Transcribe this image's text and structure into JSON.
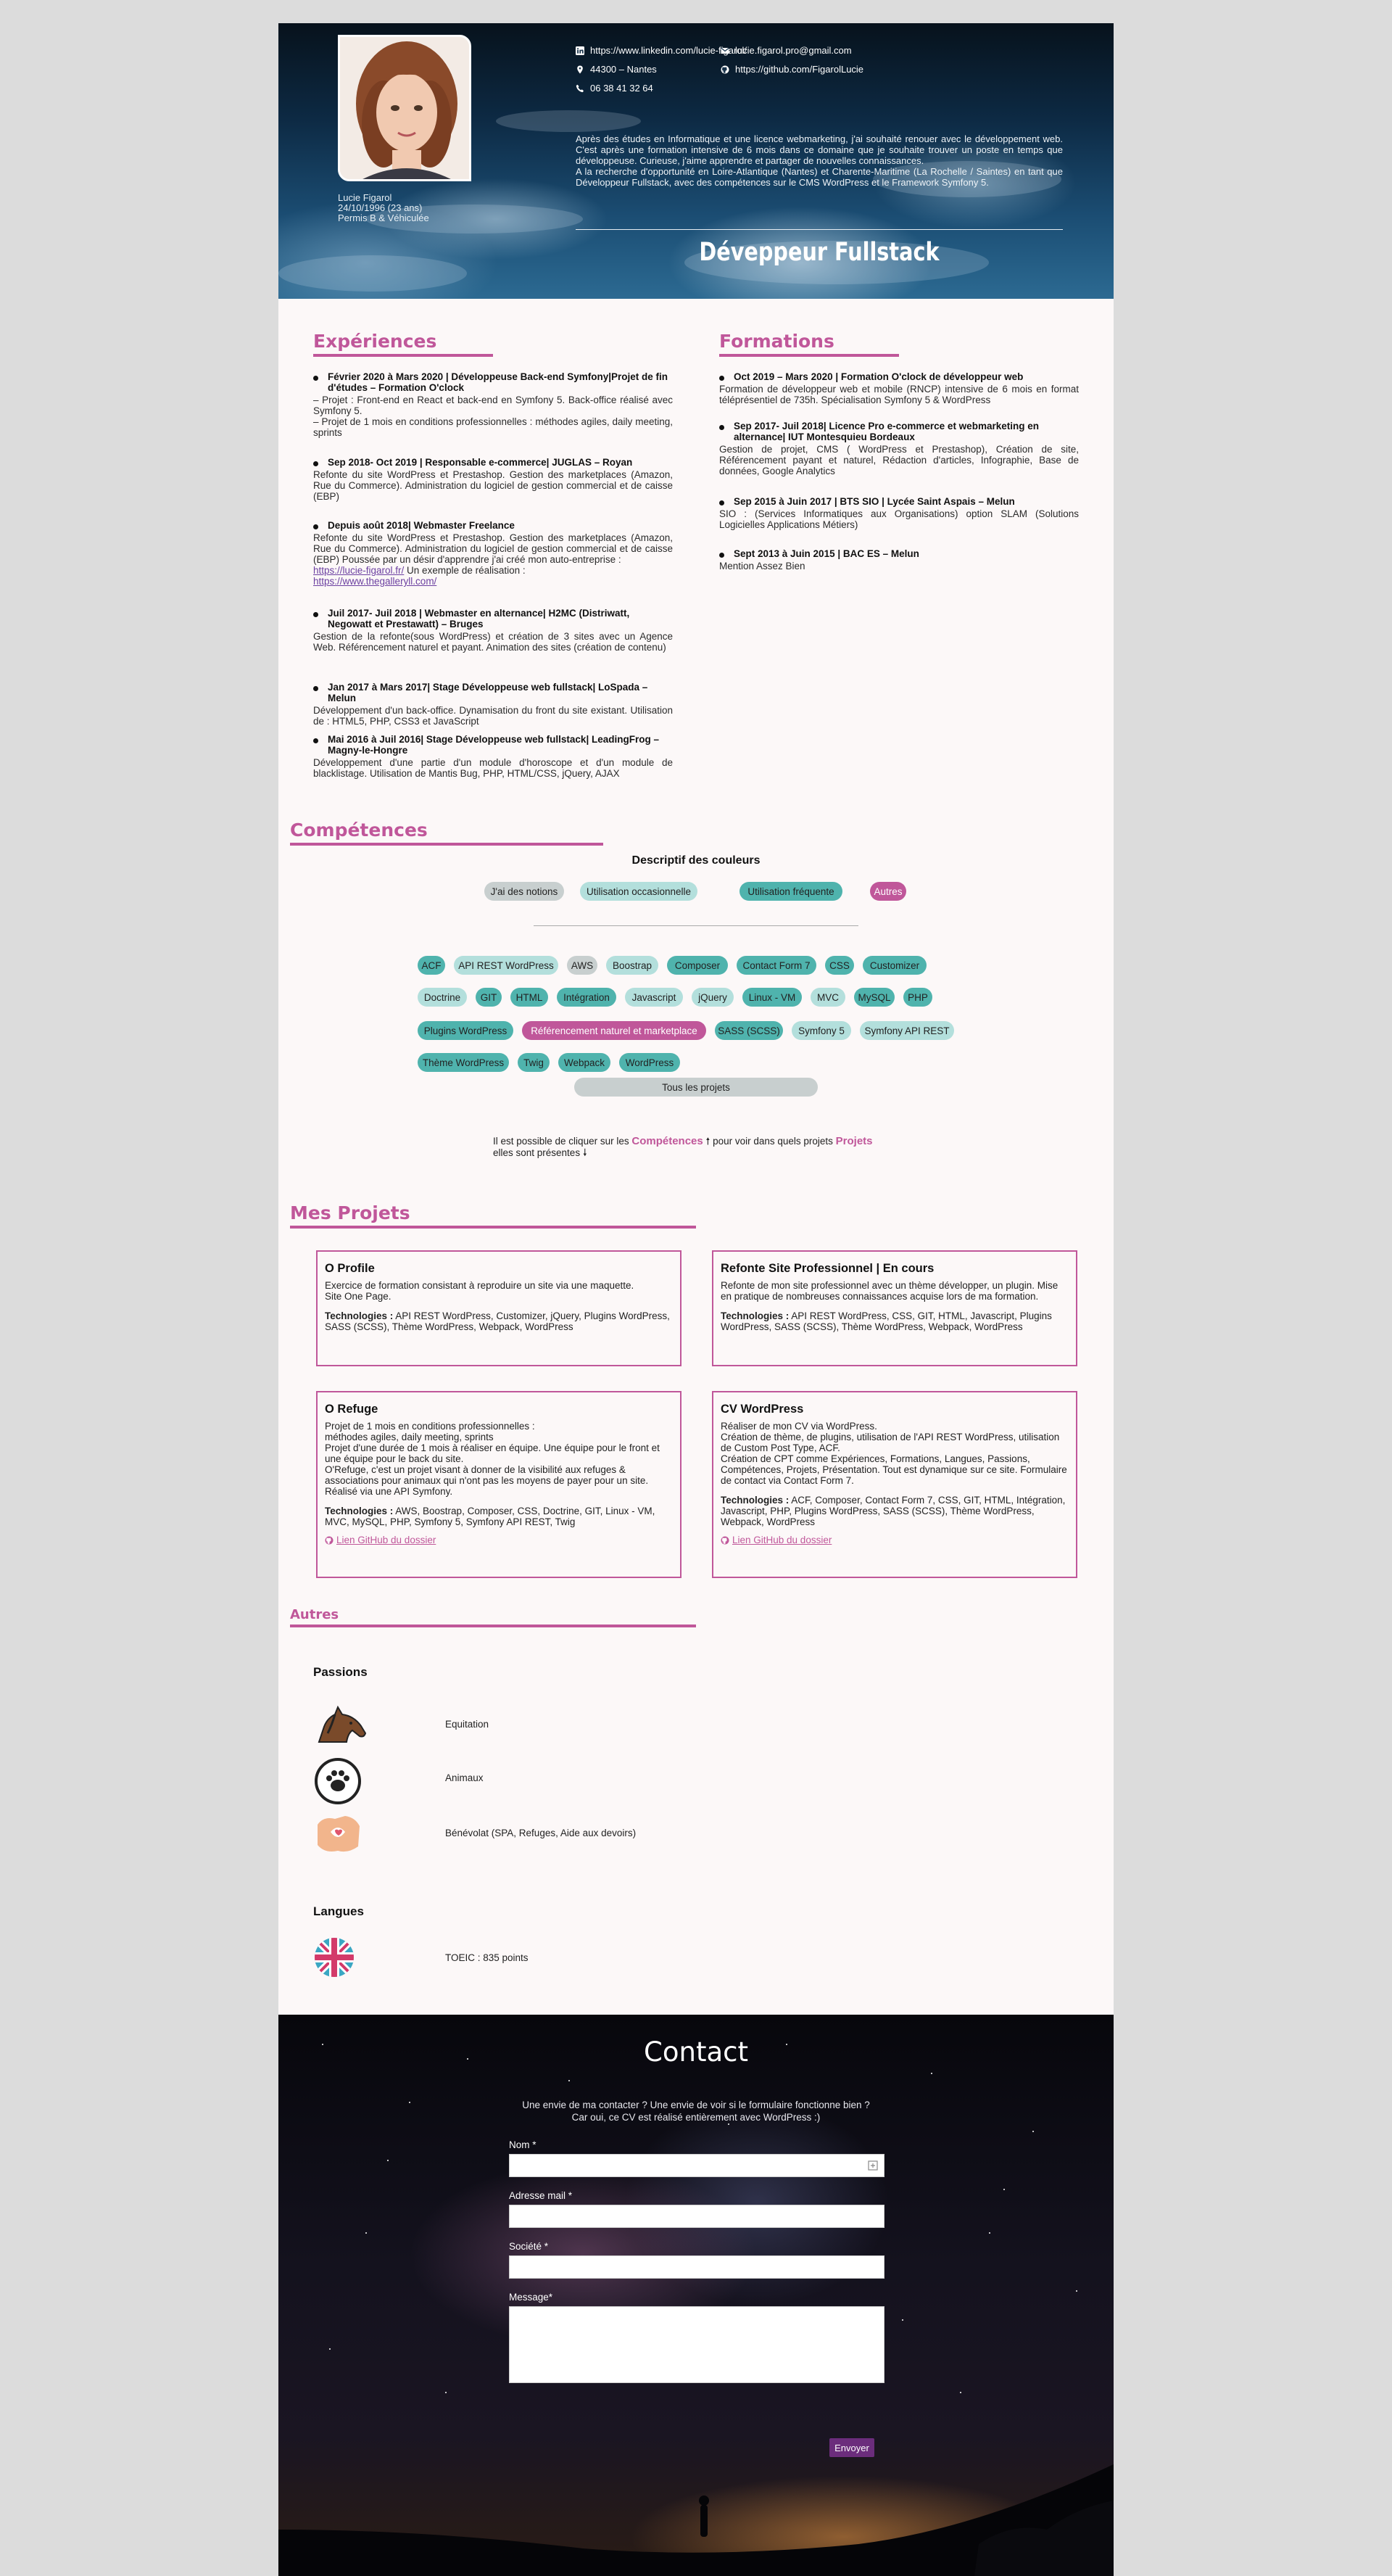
{
  "header": {
    "name": "Lucie Figarol",
    "birth": "24/10/1996 (23 ans)",
    "permit": "Permis B & Véhiculée",
    "linkedin": "https://www.linkedin.com/lucie-figarol/",
    "email": "lucie.figarol.pro@gmail.com",
    "location": "44300 – Nantes",
    "github": "https://github.com/FigarolLucie",
    "phone": "06 38 41 32 64",
    "bio_1": "Après des études en Informatique et une licence webmarketing, j'ai souhaité renouer avec le développement web. C'est après une formation intensive de 6 mois dans ce domaine que je souhaite trouver un poste en temps que développeuse. Curieuse, j'aime apprendre et partager de nouvelles connaissances.",
    "bio_2": "A la recherche d'opportunité en Loire-Atlantique (Nantes) et Charente-Maritime (La Rochelle / Saintes) en tant que Développeur Fullstack, avec des compétences sur le CMS WordPress et le Framework Symfony 5.",
    "title": "Déveppeur Fullstack"
  },
  "experiences": {
    "title": "Expériences",
    "items": [
      {
        "t": "Février 2020 à Mars 2020 | Développeuse Back-end Symfony|Projet de fin d'études – Formation O'clock",
        "d": "– Projet : Front-end en React et back-end en Symfony 5. Back-office réalisé avec Symfony 5.\n– Projet de 1 mois en conditions professionnelles : méthodes agiles, daily meeting, sprints"
      },
      {
        "t": "Sep 2018- Oct 2019 | Responsable e-commerce| JUGLAS – Royan",
        "d": "Refonte du site WordPress et Prestashop. Gestion des marketplaces (Amazon, Rue du Commerce). Administration du logiciel de gestion commercial et de caisse (EBP)"
      },
      {
        "t": "Depuis août 2018| Webmaster Freelance",
        "d": "Refonte du site WordPress et Prestashop. Gestion des marketplaces (Amazon, Rue du Commerce). Administration du logiciel de gestion commercial et de caisse (EBP) Poussée par un désir d'apprendre j'ai créé mon auto-entreprise :",
        "l1": "https://lucie-figarol.fr/",
        "mid": " Un exemple de réalisation :",
        "l2": "https://www.thegalleryll.com/"
      },
      {
        "t": "Juil 2017- Juil 2018 | Webmaster en alternance| H2MC (Distriwatt, Negowatt et Prestawatt) – Bruges",
        "d": "Gestion de la refonte(sous WordPress) et création de 3 sites avec un Agence Web. Référencement naturel et payant. Animation des sites (création de contenu)"
      },
      {
        "t": "Jan 2017 à Mars 2017| Stage Développeuse web fullstack| LoSpada – Melun",
        "d": "Développement d'un back-office. Dynamisation du front du site existant. Utilisation de : HTML5, PHP, CSS3 et JavaScript"
      },
      {
        "t": "Mai 2016 à Juil 2016| Stage Développeuse web fullstack| LeadingFrog – Magny-le-Hongre",
        "d": "Développement d'une partie d'un module d'horoscope et d'un module de blacklistage. Utilisation de Mantis Bug, PHP, HTML/CSS, jQuery, AJAX"
      }
    ]
  },
  "formations": {
    "title": "Formations",
    "items": [
      {
        "t": "Oct 2019 – Mars 2020 | Formation O'clock de développeur web",
        "d": "Formation de développeur web et mobile (RNCP) intensive de 6 mois en format téléprésentiel de 735h. Spécialisation Symfony 5 & WordPress"
      },
      {
        "t": "Sep 2017- Juil 2018| Licence Pro e-commerce et webmarketing en alternance| IUT Montesquieu Bordeaux",
        "d": "Gestion de projet, CMS ( WordPress et Prestashop), Création de site, Référencement payant et naturel, Rédaction d'articles, Infographie, Base de données, Google Analytics"
      },
      {
        "t": "Sep 2015 à Juin 2017 | BTS SIO | Lycée Saint Aspais – Melun",
        "d": "SIO : (Services Informatiques aux Organisations) option SLAM (Solutions Logicielles Applications Métiers)"
      },
      {
        "t": "Sept 2013 à Juin 2015 | BAC ES – Melun",
        "d": "Mention Assez Bien"
      }
    ]
  },
  "competences": {
    "title": "Compétences",
    "legend_title": "Descriptif des couleurs",
    "legend": [
      "J'ai des notions",
      "Utilisation occasionnelle",
      "Utilisation fréquente",
      "Autres"
    ],
    "skills": [
      "ACF",
      "API REST WordPress",
      "AWS",
      "Boostrap",
      "Composer",
      "Contact Form 7",
      "CSS",
      "Customizer",
      "Doctrine",
      "GIT",
      "HTML",
      "Intégration",
      "Javascript",
      "jQuery",
      "Linux - VM",
      "MVC",
      "MySQL",
      "PHP",
      "Plugins WordPress",
      "Référencement naturel et marketplace",
      "SASS (SCSS)",
      "Symfony 5",
      "Symfony API REST",
      "Thème WordPress",
      "Twig",
      "Webpack",
      "WordPress"
    ],
    "all_projects": "Tous les projets",
    "hint_1": "Il est possible de cliquer sur les",
    "hint_link1": "Compétences",
    "hint_2": "pour voir dans quels projets",
    "hint_link2": "Projets",
    "hint_3": "elles sont présentes",
    "colors": {
      "frequent": "#4fb3ad",
      "occasional": "#b3dfdc",
      "notions": "#c8cfcf",
      "other": "#c0579a"
    }
  },
  "projects": {
    "title": "Mes Projets",
    "tech_label": "Technologies :",
    "github_label": "Lien GitHub du dossier",
    "items": [
      {
        "title": "O Profile",
        "desc": "Exercice de formation consistant à reproduire un site via une maquette.\nSite One Page.",
        "tech": "API REST WordPress, Customizer, jQuery, Plugins WordPress, SASS (SCSS), Thème WordPress, Webpack, WordPress"
      },
      {
        "title": "Refonte Site Professionnel | En cours",
        "desc": "Refonte de mon site professionnel avec un thème développer, un plugin. Mise en pratique de nombreuses connaissances acquise lors de ma formation.",
        "tech": "API REST WordPress, CSS, GIT, HTML, Javascript, Plugins WordPress, SASS (SCSS), Thème WordPress, Webpack, WordPress"
      },
      {
        "title": "O Refuge",
        "desc": "Projet de 1 mois en conditions professionnelles :\nméthodes agiles, daily meeting, sprints\nProjet d'une durée de 1 mois à réaliser en équipe. Une équipe pour le front et une équipe pour le back du site.\nO'Refuge, c'est un projet visant à donner de la visibilité aux refuges & associations pour animaux qui n'ont pas les moyens de payer pour un site. Réalisé via une API Symfony.",
        "tech": "AWS, Boostrap, Composer, CSS, Doctrine, GIT, Linux - VM, MVC, MySQL, PHP, Symfony 5, Symfony API REST, Twig"
      },
      {
        "title": "CV WordPress",
        "desc": "Réaliser de mon CV via WordPress.\nCréation de thème, de plugins, utilisation de l'API REST WordPress, utilisation de Custom Post Type, ACF.\nCréation de CPT comme Expériences, Formations, Langues, Passions, Compétences, Projets, Présentation. Tout est dynamique sur ce site. Formulaire de contact via Contact Form 7.",
        "tech": "ACF, Composer, Contact Form 7, CSS, GIT, HTML, Intégration, Javascript, PHP, Plugins WordPress, SASS (SCSS), Thème WordPress, Webpack, WordPress"
      }
    ]
  },
  "autres": {
    "title": "Autres",
    "passions_title": "Passions",
    "passions": [
      "Equitation",
      "Animaux",
      "Bénévolat (SPA, Refuges, Aide aux devoirs)"
    ],
    "langues_title": "Langues",
    "langues": [
      "TOEIC : 835 points"
    ]
  },
  "contact": {
    "title": "Contact",
    "sub_1": "Une envie de ma contacter ? Une envie de voir si le formulaire fonctionne bien ?",
    "sub_2": "Car oui, ce CV est réalisé entièrement avec WordPress :)",
    "name_label": "Nom *",
    "email_label": "Adresse mail *",
    "company_label": "Société *",
    "message_label": "Message*",
    "send": "Envoyer"
  }
}
